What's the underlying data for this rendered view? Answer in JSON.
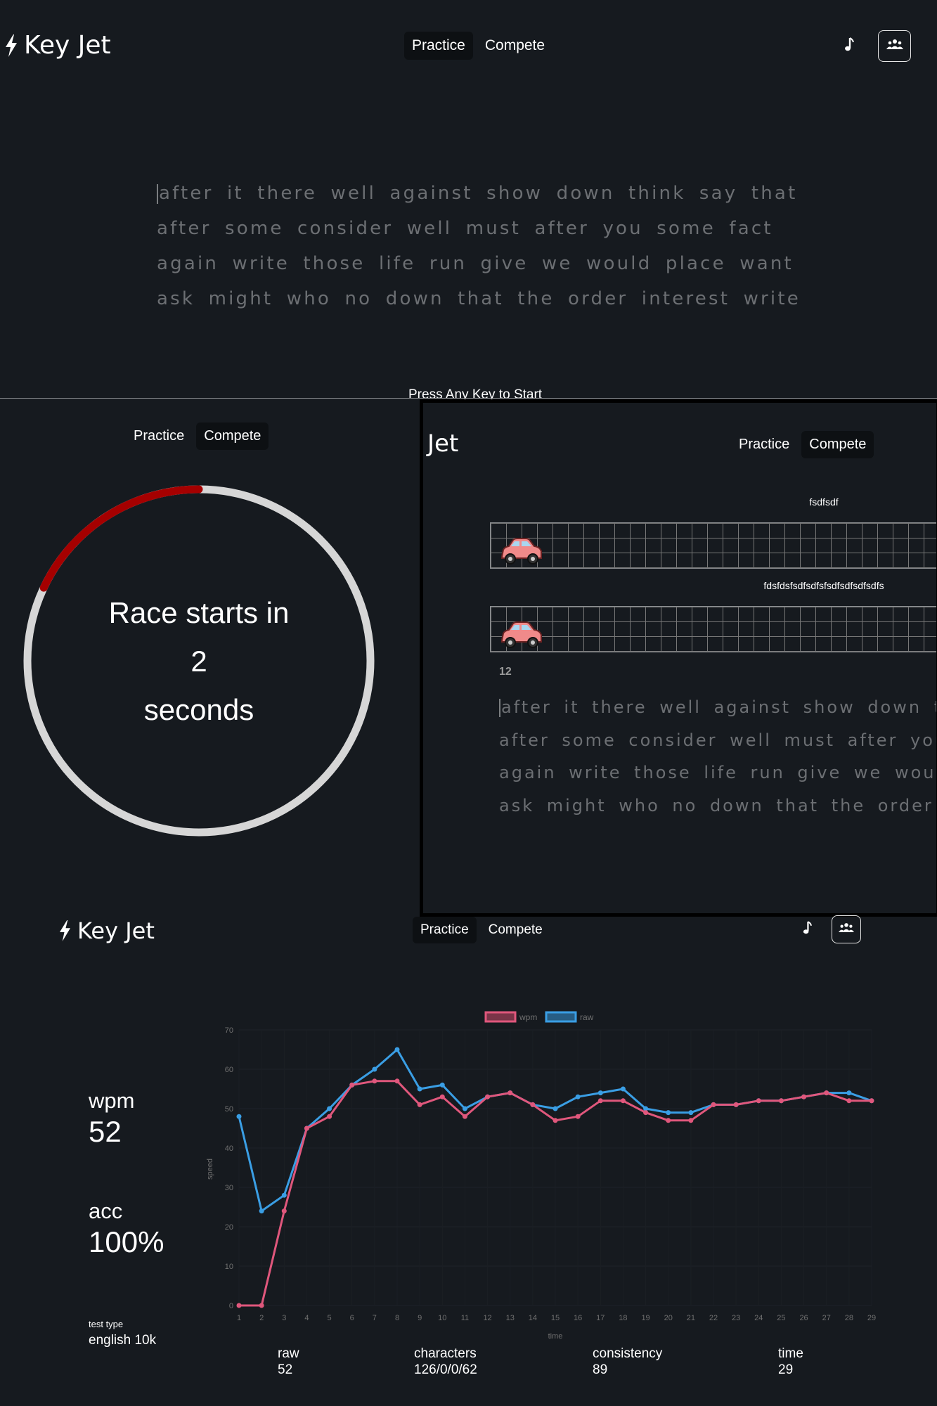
{
  "header": {
    "logo_text": "Key Jet",
    "nav": [
      {
        "label": "Practice",
        "active": true
      },
      {
        "label": "Compete",
        "active": false
      }
    ],
    "music_icon": "music-note-icon",
    "multiplayer_icon": "group-icon"
  },
  "typing": {
    "lines": [
      "after it there well against show down think say that",
      "after some consider well must after you some fact",
      "again write those life run give we would place want",
      "ask might who no down that the order interest write"
    ],
    "prompt": "Press Any Key to Start"
  },
  "countdown": {
    "nav": [
      {
        "label": "Practice",
        "active": false
      },
      {
        "label": "Compete",
        "active": true
      }
    ],
    "line1": "Race starts in",
    "seconds": "2",
    "line3": "seconds",
    "progress": 0.18
  },
  "race": {
    "logo_text": "Jet",
    "nav": [
      {
        "label": "Practice",
        "active": false
      },
      {
        "label": "Compete",
        "active": true
      }
    ],
    "racers": [
      {
        "name": "fsdfsdf",
        "icon": "car-icon"
      },
      {
        "name": "fdsfdsfsdfsdfsfsdfsdfsdfsdfs",
        "icon": "car-icon"
      }
    ],
    "counter": "12",
    "lines": [
      "after it there well against show down think say that",
      "after some consider well must after you some fact",
      "again write those life run give we would place want",
      "ask might who no down that the order interest write"
    ]
  },
  "results_header": {
    "logo_text": "Key Jet",
    "nav": [
      {
        "label": "Practice",
        "active": true
      },
      {
        "label": "Compete",
        "active": false
      }
    ]
  },
  "results": {
    "wpm_label": "wpm",
    "wpm": "52",
    "acc_label": "acc",
    "acc": "100%",
    "test_type_label": "test type",
    "test_type": "english 10k",
    "bottom": [
      {
        "label": "raw",
        "value": "52"
      },
      {
        "label": "characters",
        "value": "126/0/0/62"
      },
      {
        "label": "consistency",
        "value": "89"
      },
      {
        "label": "time",
        "value": "29"
      }
    ]
  },
  "chart_data": {
    "type": "line",
    "x": [
      1,
      2,
      3,
      4,
      5,
      6,
      7,
      8,
      9,
      10,
      11,
      12,
      13,
      14,
      15,
      16,
      17,
      18,
      19,
      20,
      21,
      22,
      23,
      24,
      25,
      26,
      27,
      28,
      29
    ],
    "series": [
      {
        "name": "wpm",
        "color": "#e0577c",
        "values": [
          0,
          0,
          24,
          45,
          48,
          56,
          57,
          57,
          51,
          53,
          48,
          53,
          54,
          51,
          47,
          48,
          52,
          52,
          49,
          47,
          47,
          51,
          51,
          52,
          52,
          53,
          54,
          52,
          52
        ]
      },
      {
        "name": "raw",
        "color": "#3a9ee4",
        "values": [
          48,
          24,
          28,
          45,
          50,
          56,
          60,
          65,
          55,
          56,
          50,
          53,
          54,
          51,
          50,
          53,
          54,
          55,
          50,
          49,
          49,
          51,
          51,
          52,
          52,
          53,
          54,
          54,
          52
        ]
      }
    ],
    "xlabel": "time",
    "ylabel": "speed",
    "ylim": [
      0,
      70
    ],
    "yticks": [
      0,
      10,
      20,
      30,
      40,
      50,
      60,
      70
    ],
    "legend": "top-center"
  }
}
